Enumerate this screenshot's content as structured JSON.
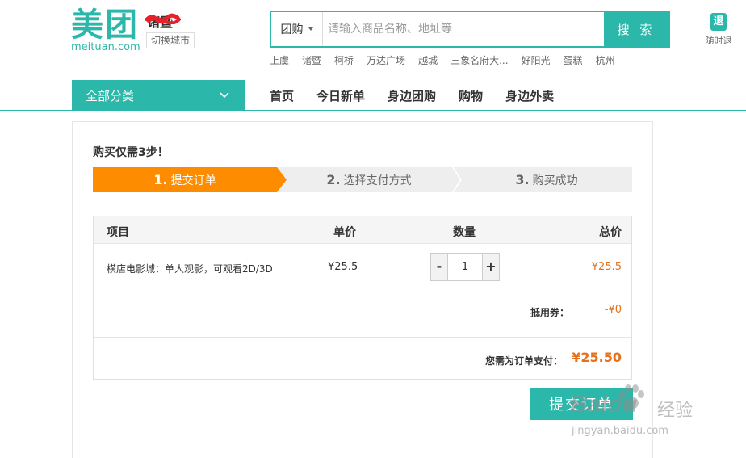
{
  "header": {
    "logo_cn": "美团",
    "logo_en": "meituan.com",
    "city": "诸暨",
    "switch_city": "切换城市",
    "search": {
      "type_label": "团购",
      "placeholder": "请输入商品名称、地址等",
      "button": "搜 索"
    },
    "hot_words": [
      "上虞",
      "诸暨",
      "柯桥",
      "万达广场",
      "越城",
      "三象名府大...",
      "好阳光",
      "蛋糕",
      "杭州"
    ],
    "quit_icon": "退",
    "quit_label": "随时退"
  },
  "nav": {
    "all_categories": "全部分类",
    "links": [
      "首页",
      "今日新单",
      "身边团购",
      "购物",
      "身边外卖"
    ]
  },
  "order": {
    "steps_title": "购买仅需3步！",
    "steps": [
      {
        "num": "1.",
        "label": "提交订单",
        "active": true
      },
      {
        "num": "2.",
        "label": "选择支付方式",
        "active": false
      },
      {
        "num": "3.",
        "label": "购买成功",
        "active": false
      }
    ],
    "table": {
      "headers": {
        "item": "项目",
        "unit_price": "单价",
        "quantity": "数量",
        "total": "总价"
      },
      "rows": [
        {
          "item": "横店电影城：单人观影，可观看2D/3D",
          "unit_price": "¥25.5",
          "quantity": "1",
          "total": "¥25.5"
        }
      ],
      "qty_minus": "-",
      "qty_plus": "+",
      "voucher_label": "抵用券：",
      "voucher_value": "-¥0",
      "pay_label": "您需为订单支付：",
      "pay_value": "¥25.50"
    },
    "submit": "提交订单"
  },
  "watermark": {
    "brand": "Baidu",
    "cn": "经验",
    "url": "jingyan.baidu.com"
  },
  "colors": {
    "brand": "#2bb8aa",
    "active_step": "#fe8c00",
    "price": "#e5711d"
  }
}
